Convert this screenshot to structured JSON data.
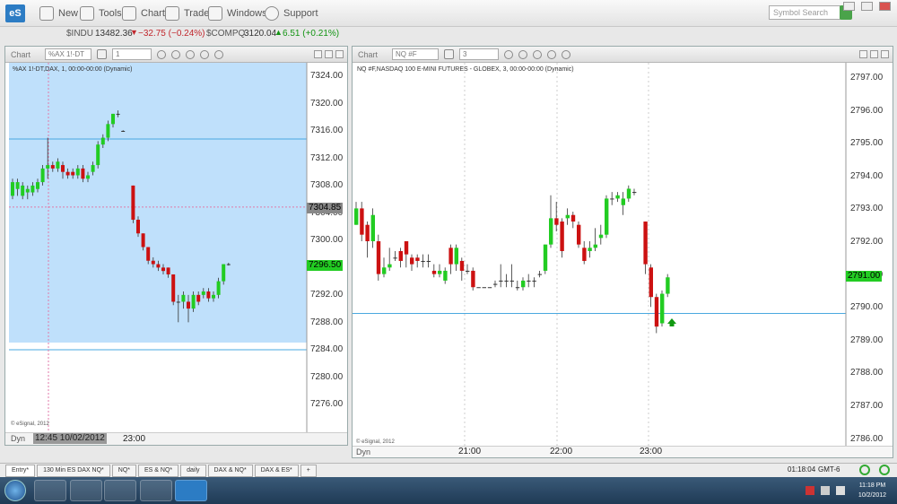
{
  "app": {
    "logo": "eS"
  },
  "toolbar": {
    "new_label": "New",
    "tools_label": "Tools",
    "chart_label": "Chart",
    "trade_label": "Trade",
    "windows_label": "Windows",
    "support_label": "Support",
    "search_placeholder": "Symbol Search"
  },
  "ticker": {
    "indu_sym": "$INDU",
    "indu_last": "13482.36",
    "indu_chg": "−32.75 (−0.24%)",
    "compq_sym": "$COMPQ",
    "compq_last": "3120.04",
    "compq_chg": "6.51 (+0.21%)"
  },
  "chart_left": {
    "header_label": "Chart",
    "symbol": "%AX 1!-DT",
    "interval": "1",
    "title": "%AX 1!-DT,DAX, 1, 00:00-00:00 (Dynamic)",
    "price_labels": [
      "7324.00",
      "7320.00",
      "7316.00",
      "7312.00",
      "7308.00",
      "7304.00",
      "7300.00",
      "7296.00",
      "7292.00",
      "7288.00",
      "7284.00",
      "7280.00",
      "7276.00"
    ],
    "cursor_price": "7304.85",
    "last_price": "7296.50",
    "credit": "© eSignal, 2012",
    "dyn": "Dyn",
    "cursor_time": "12:45 10/02/2012",
    "time_label": "23:00"
  },
  "chart_right": {
    "header_label": "Chart",
    "symbol": "NQ #F",
    "interval": "3",
    "title": "NQ #F,NASDAQ 100 E-MINI FUTURES - GLOBEX, 3, 00:00-00:00 (Dynamic)",
    "price_labels": [
      "2797.00",
      "2796.00",
      "2795.00",
      "2794.00",
      "2793.00",
      "2792.00",
      "2791.00",
      "2790.00",
      "2789.00",
      "2788.00",
      "2787.00",
      "2786.00"
    ],
    "last_price": "2791.00",
    "credit": "© eSignal, 2012",
    "dyn": "Dyn",
    "time_labels": [
      "21:00",
      "22:00",
      "23:00"
    ]
  },
  "bottom_tabs": [
    "Entry*",
    "130 Min ES DAX NQ*",
    "NQ*",
    "ES & NQ*",
    "daily",
    "DAX & NQ*",
    "DAX & ES*",
    "+"
  ],
  "status": {
    "time": "01:18:04",
    "zone": "GMT-6"
  },
  "taskbar": {
    "time": "11:18 PM",
    "date": "10/2/2012"
  },
  "colors": {
    "up": "#22cc22",
    "down": "#cc1111",
    "left_bg": "#bfe0fb",
    "line": "#4aa8e0"
  }
}
